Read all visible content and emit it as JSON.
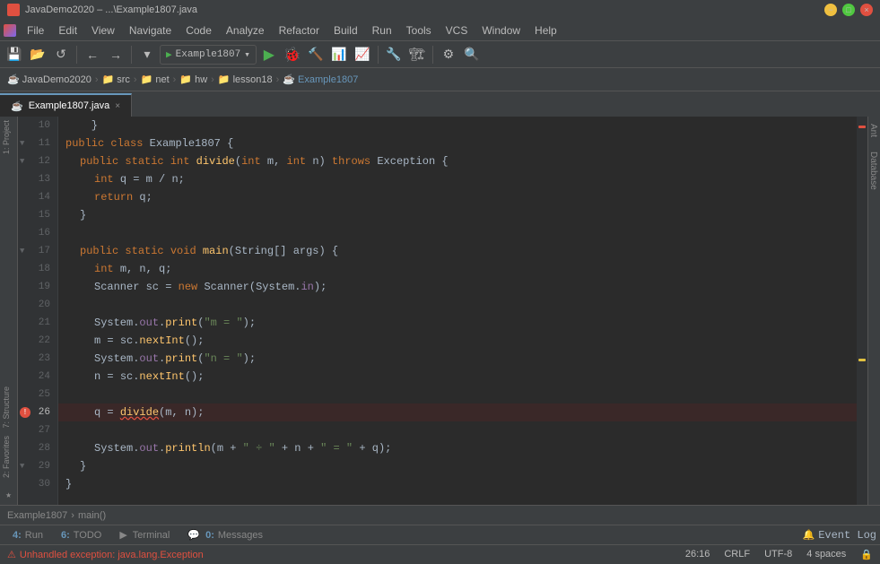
{
  "titlebar": {
    "title": "JavaDemo2020 – ...\\Example1807.java",
    "min": "−",
    "max": "□",
    "close": "×"
  },
  "menubar": {
    "items": [
      "File",
      "Edit",
      "View",
      "Navigate",
      "Code",
      "Analyze",
      "Refactor",
      "Build",
      "Run",
      "Tools",
      "VCS",
      "Window",
      "Help"
    ]
  },
  "toolbar": {
    "run_config": "Example1807",
    "buttons": [
      "◀◀",
      "◀",
      "↺",
      "→",
      "←"
    ]
  },
  "breadcrumb": {
    "items": [
      "JavaDemo2020",
      "src",
      "net",
      "hw",
      "lesson18",
      "Example1807"
    ]
  },
  "tab": {
    "filename": "Example1807.java"
  },
  "code": {
    "lines": [
      {
        "num": 10,
        "content": "    }",
        "indent": 4
      },
      {
        "num": 11,
        "content": "    public class Example1807 {",
        "hasFold": true
      },
      {
        "num": 12,
        "content": "        public static int divide(int m, int n) throws Exception {",
        "hasFold": true
      },
      {
        "num": 13,
        "content": "            int q = m / n;"
      },
      {
        "num": 14,
        "content": "            return q;"
      },
      {
        "num": 15,
        "content": "        }"
      },
      {
        "num": 16,
        "content": ""
      },
      {
        "num": 17,
        "content": "        public static void main(String[] args) {",
        "hasFold": true
      },
      {
        "num": 18,
        "content": "            int m, n, q;"
      },
      {
        "num": 19,
        "content": "            Scanner sc = new Scanner(System.in);"
      },
      {
        "num": 20,
        "content": ""
      },
      {
        "num": 21,
        "content": "            System.out.print(\"m = \");"
      },
      {
        "num": 22,
        "content": "            m = sc.nextInt();"
      },
      {
        "num": 23,
        "content": "            System.out.print(\"n = \");"
      },
      {
        "num": 24,
        "content": "            n = sc.nextInt();"
      },
      {
        "num": 25,
        "content": ""
      },
      {
        "num": 26,
        "content": "            q = divide(m, n);",
        "hasError": true,
        "isHighlighted": false,
        "errorLine": true
      },
      {
        "num": 27,
        "content": ""
      },
      {
        "num": 28,
        "content": "            System.out.println(m + \" ÷ \" + n + \" = \" + q);"
      },
      {
        "num": 29,
        "content": "        }",
        "hasFold2": true
      },
      {
        "num": 30,
        "content": "    }"
      }
    ]
  },
  "bottom_nav": {
    "breadcrumb_method": "Example1807",
    "breadcrumb_sep": "›",
    "method": "main()"
  },
  "bottom_tabs": [
    {
      "num": "4",
      "label": "Run"
    },
    {
      "num": "6",
      "label": "TODO"
    },
    {
      "num": "",
      "label": "Terminal"
    },
    {
      "num": "0",
      "label": "Messages"
    }
  ],
  "statusbar": {
    "error_text": "Unhandled exception: java.lang.Exception",
    "position": "26:16",
    "line_sep": "CRLF",
    "encoding": "UTF-8",
    "indent": "4 spaces",
    "event_log": "Event Log"
  },
  "right_panel": {
    "tabs": [
      "Ant",
      "Database"
    ]
  }
}
